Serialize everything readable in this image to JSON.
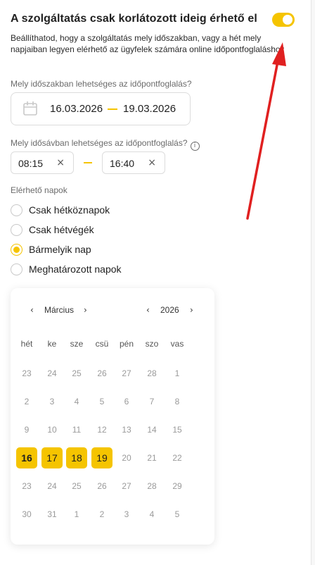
{
  "header": {
    "title": "A szolgáltatás csak korlátozott ideig érhető el",
    "toggle_on": true,
    "accent_color": "#f5c400"
  },
  "description": "Beállíthatod, hogy a szolgáltatás mely időszakban, vagy a hét mely napjaiban legyen elérhető az ügyfelek számára online időpontfoglaláshoz",
  "period": {
    "label": "Mely időszakban lehetséges az időpontfoglalás?",
    "start": "16.03.2026",
    "end": "19.03.2026",
    "icon": "calendar-icon"
  },
  "time_range": {
    "label": "Mely idősávban lehetséges az időpontfoglalás?",
    "info_icon": "i",
    "start": "08:15",
    "end": "16:40",
    "clear_symbol": "×"
  },
  "days": {
    "label": "Elérhető napok",
    "options": [
      {
        "label": "Csak hétköznapok",
        "checked": false
      },
      {
        "label": "Csak hétvégék",
        "checked": false
      },
      {
        "label": "Bármelyik nap",
        "checked": true
      },
      {
        "label": "Meghatározott napok",
        "checked": false
      }
    ]
  },
  "calendar": {
    "month": "Március",
    "year": "2026",
    "prev_symbol": "‹",
    "next_symbol": "›",
    "weekdays": [
      "hét",
      "ke",
      "sze",
      "csü",
      "pén",
      "szo",
      "vas"
    ],
    "weeks": [
      [
        "23",
        "24",
        "25",
        "26",
        "27",
        "28",
        "1"
      ],
      [
        "2",
        "3",
        "4",
        "5",
        "6",
        "7",
        "8"
      ],
      [
        "9",
        "10",
        "11",
        "12",
        "13",
        "14",
        "15"
      ],
      [
        "16",
        "17",
        "18",
        "19",
        "20",
        "21",
        "22"
      ],
      [
        "23",
        "24",
        "25",
        "26",
        "27",
        "28",
        "29"
      ],
      [
        "30",
        "31",
        "1",
        "2",
        "3",
        "4",
        "5"
      ]
    ],
    "selected": [
      "16",
      "17",
      "18",
      "19"
    ],
    "today": "16"
  }
}
